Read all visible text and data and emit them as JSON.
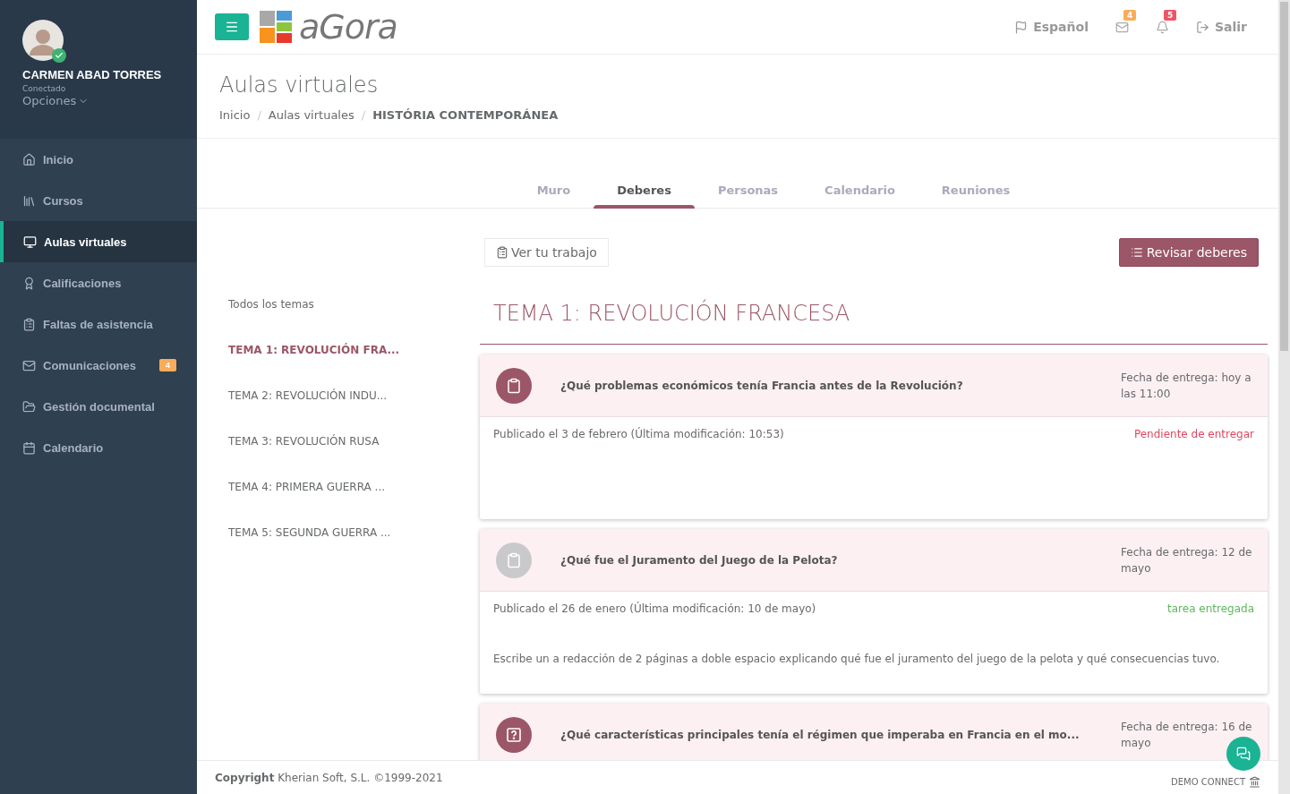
{
  "user": {
    "name": "CARMEN ABAD TORRES",
    "status": "Conectado",
    "options": "Opciones"
  },
  "nav": [
    {
      "label": "Inicio",
      "selected": false
    },
    {
      "label": "Cursos",
      "selected": false
    },
    {
      "label": "Aulas virtuales",
      "selected": true
    },
    {
      "label": "Calificaciones",
      "selected": false
    },
    {
      "label": "Faltas de asistencia",
      "selected": false
    },
    {
      "label": "Comunicaciones",
      "selected": false,
      "badge": "4"
    },
    {
      "label": "Gestión documental",
      "selected": false
    },
    {
      "label": "Calendario",
      "selected": false
    }
  ],
  "logo": "aGora",
  "topbar": {
    "language": "Español",
    "mail_badge": "4",
    "bell_badge": "5",
    "logout": "Salir"
  },
  "page": {
    "title": "Aulas virtuales",
    "breadcrumb": [
      "Inicio",
      "Aulas virtuales",
      "HISTÓRIA CONTEMPORÁNEA"
    ],
    "breadcrumb_separators": [
      "/",
      "/"
    ]
  },
  "tabs": [
    {
      "label": "Muro",
      "selected": false
    },
    {
      "label": "Deberes",
      "selected": true
    },
    {
      "label": "Personas",
      "selected": false
    },
    {
      "label": "Calendario",
      "selected": false
    },
    {
      "label": "Reuniones",
      "selected": false
    }
  ],
  "topics": [
    {
      "label": "Todos los temas",
      "selected": false
    },
    {
      "label": "TEMA 1: REVOLUCIÓN FRA...",
      "selected": true
    },
    {
      "label": "TEMA 2: REVOLUCIÓN INDU...",
      "selected": false
    },
    {
      "label": "TEMA 3: REVOLUCIÓN RUSA",
      "selected": false
    },
    {
      "label": "TEMA 4: PRIMERA GUERRA ...",
      "selected": false
    },
    {
      "label": "TEMA 5: SEGUNDA GUERRA ...",
      "selected": false
    }
  ],
  "actions": {
    "view_work": "Ver tu trabajo",
    "review": "Revisar deberes"
  },
  "section_title": "TEMA 1: REVOLUCIÓN FRANCESA",
  "tasks": [
    {
      "kind": "assignment",
      "completed": false,
      "title": "¿Qué problemas económicos tenía Francia antes de la Revolución?",
      "due": "Fecha de entrega: hoy a las 11:00",
      "posted": "Publicado el 3 de febrero (Última modificación: 10:53)",
      "delivered": false,
      "status_text": "Pendiente de entregar"
    },
    {
      "kind": "assignment",
      "completed": true,
      "title": "¿Qué fue el Juramento del Juego de la Pelota?",
      "due": "Fecha de entrega: 12 de mayo",
      "posted": "Publicado el 26 de enero (Última modificación: 10 de mayo)",
      "delivered": true,
      "status_text": "tarea entregada",
      "description": "Escribe un a redacción de 2 páginas a doble espacio explicando qué fue el juramento del juego de la pelota y qué consecuencias tuvo."
    },
    {
      "kind": "question",
      "completed": false,
      "title": "¿Qué características principales tenía el régimen que imperaba en Francia en el mo...",
      "due": "Fecha de entrega: 16 de mayo"
    }
  ],
  "footer": {
    "copyright": "**Copyright** Kherian Soft, S.L. ©1999-2021",
    "brand": "DEMO CONNECT"
  }
}
